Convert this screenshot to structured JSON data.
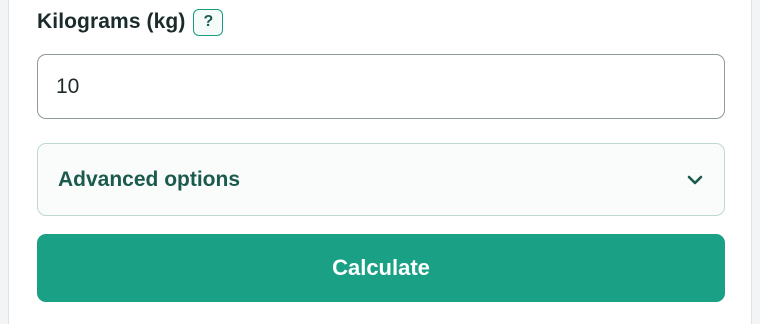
{
  "field": {
    "label": "Kilograms (kg)",
    "help_label": "?",
    "value": "10"
  },
  "advanced": {
    "label": "Advanced options",
    "icon": "chevron-down-icon"
  },
  "actions": {
    "calculate_label": "Calculate"
  },
  "colors": {
    "accent": "#1aa085",
    "accent_text": "#1c5a4d",
    "help_border": "#1a9c7f"
  }
}
